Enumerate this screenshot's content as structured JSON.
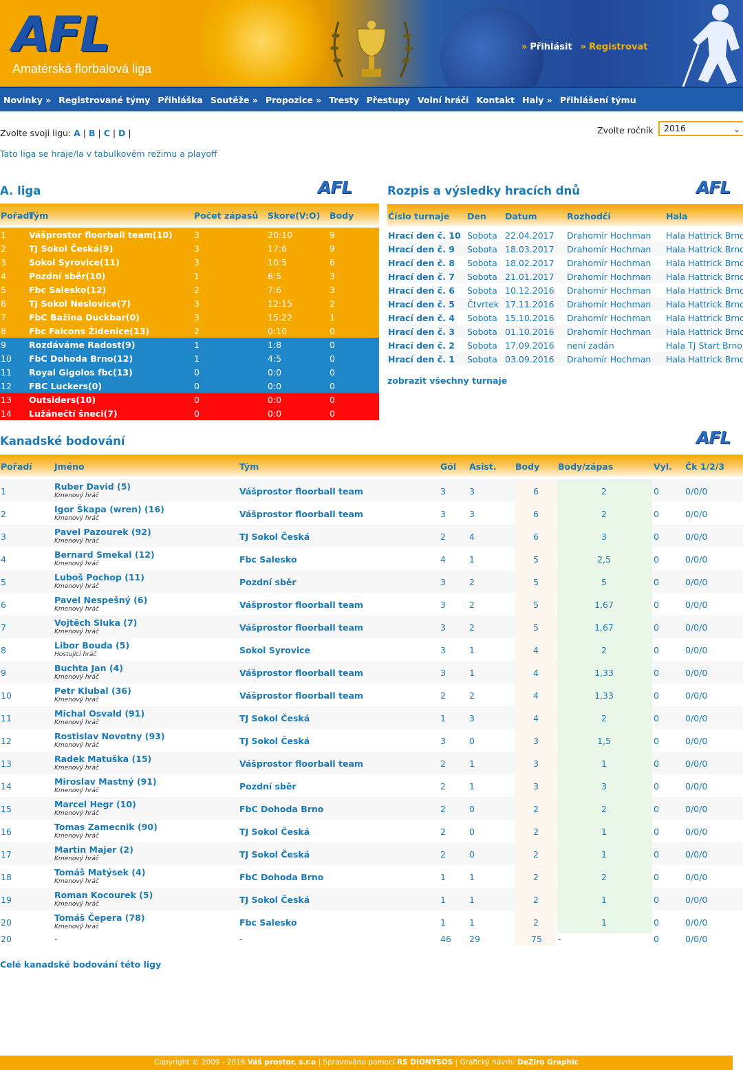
{
  "header": {
    "logo_mark": "AFL",
    "logo_subtitle": "Amatérská florbalová liga",
    "login": "Přihlásit",
    "register": "Registrovat"
  },
  "nav": [
    "Novinky »",
    "Registrované týmy",
    "Přihláška",
    "Soutěže »",
    "Propozice »",
    "Tresty",
    "Přestupy",
    "Volní hráči",
    "Kontakt",
    "Haly »",
    "Přihlášení týmu"
  ],
  "league_choose": {
    "label": "Zvolte svoji ligu:",
    "options": [
      "A",
      "B",
      "C",
      "D"
    ]
  },
  "year": {
    "label": "Zvolte ročník",
    "selected": "2016"
  },
  "mode_text": "Tato liga se hraje/la v tabulkovém režimu a playoff",
  "standings": {
    "title": "A. liga",
    "headers": {
      "rank": "Pořadí",
      "team": "Tým",
      "games": "Počet zápasů",
      "score": "Skore(V:O)",
      "points": "Body"
    },
    "rows": [
      {
        "rank": "1",
        "team": "Vášprostor floorball team(10)",
        "games": "3",
        "score": "20:10",
        "points": "9",
        "zone": "orange"
      },
      {
        "rank": "2",
        "team": "TJ Sokol Česká(9)",
        "games": "3",
        "score": "17:6",
        "points": "9",
        "zone": "orange"
      },
      {
        "rank": "3",
        "team": "Sokol Syrovice(11)",
        "games": "3",
        "score": "10:5",
        "points": "6",
        "zone": "orange"
      },
      {
        "rank": "4",
        "team": "Pozdní sběr(10)",
        "games": "1",
        "score": "6:5",
        "points": "3",
        "zone": "orange"
      },
      {
        "rank": "5",
        "team": "Fbc Salesko(12)",
        "games": "2",
        "score": "7:6",
        "points": "3",
        "zone": "orange"
      },
      {
        "rank": "6",
        "team": "TJ Sokol Neslovice(7)",
        "games": "3",
        "score": "12:15",
        "points": "2",
        "zone": "orange"
      },
      {
        "rank": "7",
        "team": "FbC Bažina Duckbar(0)",
        "games": "3",
        "score": "15:22",
        "points": "1",
        "zone": "orange"
      },
      {
        "rank": "8",
        "team": "Fbc Falcons Židenice(13)",
        "games": "2",
        "score": "0:10",
        "points": "0",
        "zone": "orange"
      },
      {
        "rank": "9",
        "team": "Rozdáváme Radost(9)",
        "games": "1",
        "score": "1:8",
        "points": "0",
        "zone": "blue"
      },
      {
        "rank": "10",
        "team": "FbC Dohoda Brno(12)",
        "games": "1",
        "score": "4:5",
        "points": "0",
        "zone": "blue"
      },
      {
        "rank": "11",
        "team": "Royal Gigolos fbc(13)",
        "games": "0",
        "score": "0:0",
        "points": "0",
        "zone": "blue"
      },
      {
        "rank": "12",
        "team": "FBC Luckers(0)",
        "games": "0",
        "score": "0:0",
        "points": "0",
        "zone": "blue"
      },
      {
        "rank": "13",
        "team": "Outsiders(10)",
        "games": "0",
        "score": "0:0",
        "points": "0",
        "zone": "red"
      },
      {
        "rank": "14",
        "team": "Lužánečtí šneci(7)",
        "games": "0",
        "score": "0:0",
        "points": "0",
        "zone": "red"
      }
    ]
  },
  "schedule": {
    "title": "Rozpis a výsledky hracích dnů",
    "headers": {
      "num": "Číslo turnaje",
      "day": "Den",
      "date": "Datum",
      "ref": "Rozhodčí",
      "hall": "Hala"
    },
    "rows": [
      {
        "num": "Hrací den č. 10",
        "day": "Sobota",
        "date": "22.04.2017",
        "ref": "Drahomír Hochman",
        "hall": "Hala Hattrick Brno"
      },
      {
        "num": "Hrací den č. 9",
        "day": "Sobota",
        "date": "18.03.2017",
        "ref": "Drahomír Hochman",
        "hall": "Hala Hattrick Brno"
      },
      {
        "num": "Hrací den č. 8",
        "day": "Sobota",
        "date": "18.02.2017",
        "ref": "Drahomír Hochman",
        "hall": "Hala Hattrick Brno"
      },
      {
        "num": "Hrací den č. 7",
        "day": "Sobota",
        "date": "21.01.2017",
        "ref": "Drahomír Hochman",
        "hall": "Hala Hattrick Brno"
      },
      {
        "num": "Hrací den č. 6",
        "day": "Sobota",
        "date": "10.12.2016",
        "ref": "Drahomír Hochman",
        "hall": "Hala Hattrick Brno"
      },
      {
        "num": "Hrací den č. 5",
        "day": "Čtvrtek",
        "date": "17.11.2016",
        "ref": "Drahomír Hochman",
        "hall": "Hala Hattrick Brno"
      },
      {
        "num": "Hrací den č. 4",
        "day": "Sobota",
        "date": "15.10.2016",
        "ref": "Drahomír Hochman",
        "hall": "Hala Hattrick Brno"
      },
      {
        "num": "Hrací den č. 3",
        "day": "Sobota",
        "date": "01.10.2016",
        "ref": "Drahomír Hochman",
        "hall": "Hala Hattrick Brno"
      },
      {
        "num": "Hrací den č. 2",
        "day": "Sobota",
        "date": "17.09.2016",
        "ref": "není zadán",
        "hall": "Hala TJ Start Brno"
      },
      {
        "num": "Hrací den č. 1",
        "day": "Sobota",
        "date": "03.09.2016",
        "ref": "Drahomír Hochman",
        "hall": "Hala Hattrick Brno"
      }
    ],
    "show_all": "zobrazit všechny turnaje"
  },
  "scoring": {
    "title": "Kanadské bodování",
    "headers": {
      "rank": "Pořadí",
      "name": "Jméno",
      "team": "Tým",
      "goals": "Gól",
      "assists": "Asist.",
      "points": "Body",
      "ppg": "Body/zápas",
      "pen": "Vyl.",
      "ck": "Čk 1/2/3"
    },
    "rows": [
      {
        "rank": "1",
        "name": "Ruber David (5)",
        "role": "Kmenový hráč",
        "team": "Vášprostor floorball team",
        "goals": "3",
        "assists": "3",
        "points": "6",
        "ppg": "2",
        "pen": "0",
        "ck": "0/0/0"
      },
      {
        "rank": "2",
        "name": "Igor Škapa (wren) (16)",
        "role": "Kmenový hráč",
        "team": "Vášprostor floorball team",
        "goals": "3",
        "assists": "3",
        "points": "6",
        "ppg": "2",
        "pen": "0",
        "ck": "0/0/0"
      },
      {
        "rank": "3",
        "name": "Pavel Pazourek (92)",
        "role": "Kmenový hráč",
        "team": "TJ Sokol Česká",
        "goals": "2",
        "assists": "4",
        "points": "6",
        "ppg": "3",
        "pen": "0",
        "ck": "0/0/0"
      },
      {
        "rank": "4",
        "name": "Bernard Smekal (12)",
        "role": "Kmenový hráč",
        "team": "Fbc Salesko",
        "goals": "4",
        "assists": "1",
        "points": "5",
        "ppg": "2,5",
        "pen": "0",
        "ck": "0/0/0"
      },
      {
        "rank": "5",
        "name": "Luboš Pochop (11)",
        "role": "Kmenový hráč",
        "team": "Pozdní sběr",
        "goals": "3",
        "assists": "2",
        "points": "5",
        "ppg": "5",
        "pen": "0",
        "ck": "0/0/0"
      },
      {
        "rank": "6",
        "name": "Pavel Nespešný (6)",
        "role": "Kmenový hráč",
        "team": "Vášprostor floorball team",
        "goals": "3",
        "assists": "2",
        "points": "5",
        "ppg": "1,67",
        "pen": "0",
        "ck": "0/0/0"
      },
      {
        "rank": "7",
        "name": "Vojtěch Sluka (7)",
        "role": "Kmenový hráč",
        "team": "Vášprostor floorball team",
        "goals": "3",
        "assists": "2",
        "points": "5",
        "ppg": "1,67",
        "pen": "0",
        "ck": "0/0/0"
      },
      {
        "rank": "8",
        "name": "Libor Bouda (5)",
        "role": "Hostující hráč",
        "team": "Sokol Syrovice",
        "goals": "3",
        "assists": "1",
        "points": "4",
        "ppg": "2",
        "pen": "0",
        "ck": "0/0/0"
      },
      {
        "rank": "9",
        "name": "Buchta Jan (4)",
        "role": "Kmenový hráč",
        "team": "Vášprostor floorball team",
        "goals": "3",
        "assists": "1",
        "points": "4",
        "ppg": "1,33",
        "pen": "0",
        "ck": "0/0/0"
      },
      {
        "rank": "10",
        "name": "Petr Klubal (36)",
        "role": "Kmenový hráč",
        "team": "Vášprostor floorball team",
        "goals": "2",
        "assists": "2",
        "points": "4",
        "ppg": "1,33",
        "pen": "0",
        "ck": "0/0/0"
      },
      {
        "rank": "11",
        "name": "Michal Osvald (91)",
        "role": "Kmenový hráč",
        "team": "TJ Sokol Česká",
        "goals": "1",
        "assists": "3",
        "points": "4",
        "ppg": "2",
        "pen": "0",
        "ck": "0/0/0"
      },
      {
        "rank": "12",
        "name": "Rostislav Novotny (93)",
        "role": "Kmenový hráč",
        "team": "TJ Sokol Česká",
        "goals": "3",
        "assists": "0",
        "points": "3",
        "ppg": "1,5",
        "pen": "0",
        "ck": "0/0/0"
      },
      {
        "rank": "13",
        "name": "Radek Matuška (15)",
        "role": "Kmenový hráč",
        "team": "Vášprostor floorball team",
        "goals": "2",
        "assists": "1",
        "points": "3",
        "ppg": "1",
        "pen": "0",
        "ck": "0/0/0"
      },
      {
        "rank": "14",
        "name": "Miroslav Mastný (91)",
        "role": "Kmenový hráč",
        "team": "Pozdní sběr",
        "goals": "2",
        "assists": "1",
        "points": "3",
        "ppg": "3",
        "pen": "0",
        "ck": "0/0/0"
      },
      {
        "rank": "15",
        "name": "Marcel Hegr (10)",
        "role": "Kmenový hráč",
        "team": "FbC Dohoda Brno",
        "goals": "2",
        "assists": "0",
        "points": "2",
        "ppg": "2",
        "pen": "0",
        "ck": "0/0/0"
      },
      {
        "rank": "16",
        "name": "Tomas Zamecnik (90)",
        "role": "Kmenový hráč",
        "team": "TJ Sokol Česká",
        "goals": "2",
        "assists": "0",
        "points": "2",
        "ppg": "1",
        "pen": "0",
        "ck": "0/0/0"
      },
      {
        "rank": "17",
        "name": "Martin Majer (2)",
        "role": "Kmenový hráč",
        "team": "TJ Sokol Česká",
        "goals": "2",
        "assists": "0",
        "points": "2",
        "ppg": "1",
        "pen": "0",
        "ck": "0/0/0"
      },
      {
        "rank": "18",
        "name": "Tomáš Matýsek (4)",
        "role": "Kmenový hráč",
        "team": "FbC Dohoda Brno",
        "goals": "1",
        "assists": "1",
        "points": "2",
        "ppg": "2",
        "pen": "0",
        "ck": "0/0/0"
      },
      {
        "rank": "19",
        "name": "Roman Kocourek (5)",
        "role": "Kmenový hráč",
        "team": "TJ Sokol Česká",
        "goals": "1",
        "assists": "1",
        "points": "2",
        "ppg": "1",
        "pen": "0",
        "ck": "0/0/0"
      },
      {
        "rank": "20",
        "name": "Tomáš Čepera (78)",
        "role": "Kmenový hráč",
        "team": "Fbc Salesko",
        "goals": "1",
        "assists": "1",
        "points": "2",
        "ppg": "1",
        "pen": "0",
        "ck": "0/0/0"
      }
    ],
    "total": {
      "rank": "20",
      "name": "-",
      "team": "-",
      "goals": "46",
      "assists": "29",
      "points": "75",
      "ppg": "-",
      "pen": "0",
      "ck": "0/0/0"
    },
    "show_all": "Celé kanadské bodování této ligy"
  },
  "footer": {
    "copyright": "Copyright © 2009 - 2016 ",
    "company": "Váš prostor, s.r.o",
    "managed": " | Spravováno pomocí ",
    "cms": "RS DIONÝSOS",
    "design": " | Grafický návrh: ",
    "designer": "DeZiro Graphic"
  },
  "colors": {
    "orange": "#f5a800",
    "blue_zone": "#1f86c8",
    "red_zone": "#ff0a0a",
    "nav": "#1f5eac",
    "link": "#1a7ab8"
  }
}
